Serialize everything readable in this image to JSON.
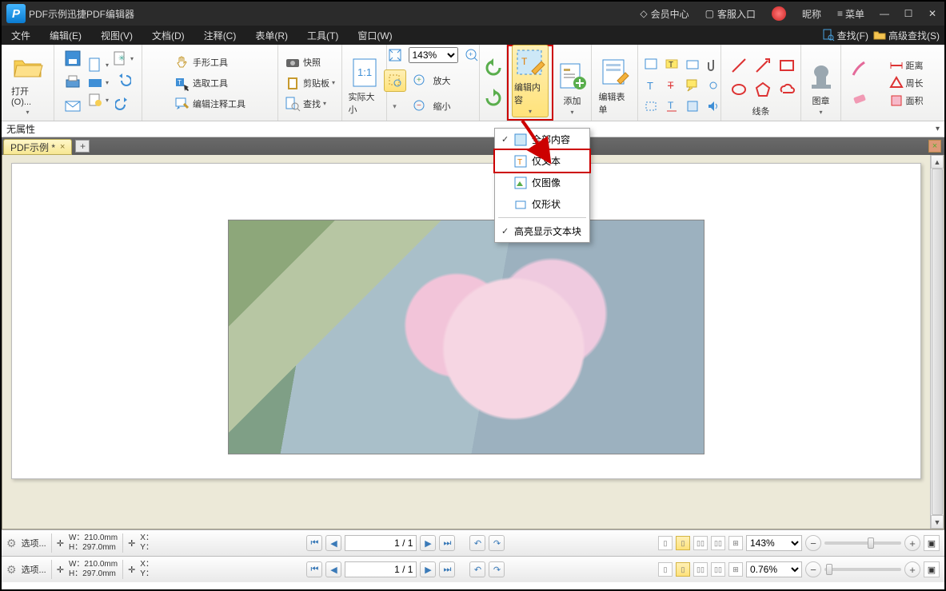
{
  "titlebar": {
    "title": "PDF示例迅捷PDF编辑器",
    "member": "会员中心",
    "support": "客服入口",
    "nick": "昵称",
    "menu": "菜单"
  },
  "menubar": {
    "items": [
      "文件",
      "编辑(E)",
      "视图(V)",
      "文档(D)",
      "注释(C)",
      "表单(R)",
      "工具(T)",
      "窗口(W)"
    ],
    "find": "查找(F)",
    "advfind": "高级查找(S)"
  },
  "ribbon": {
    "open": "打开(O)...",
    "hand": "手形工具",
    "select": "选取工具",
    "annot": "编辑注释工具",
    "snapshot": "快照",
    "clipboard": "剪贴板",
    "find": "查找",
    "actual": "实际大小",
    "zoomin": "放大",
    "zoomout": "缩小",
    "zoomval": "143%",
    "editcontent": "编辑内容",
    "add": "添加",
    "editform": "编辑表单",
    "lines": "线条",
    "stamp": "图章",
    "distance": "距离",
    "perimeter": "周长",
    "area": "面积"
  },
  "propbar": {
    "label": "无属性"
  },
  "tab": {
    "name": "PDF示例 *"
  },
  "dropdown": {
    "all": "全部内容",
    "text": "仅文本",
    "image": "仅图像",
    "shape": "仅形状",
    "highlight": "高亮显示文本块"
  },
  "status": {
    "options": "选项...",
    "w": "W：210.0mm",
    "h": "H：297.0mm",
    "x": "X：",
    "y": "Y：",
    "page": "1 / 1",
    "zoom1": "143%",
    "zoom2": "0.76%"
  }
}
